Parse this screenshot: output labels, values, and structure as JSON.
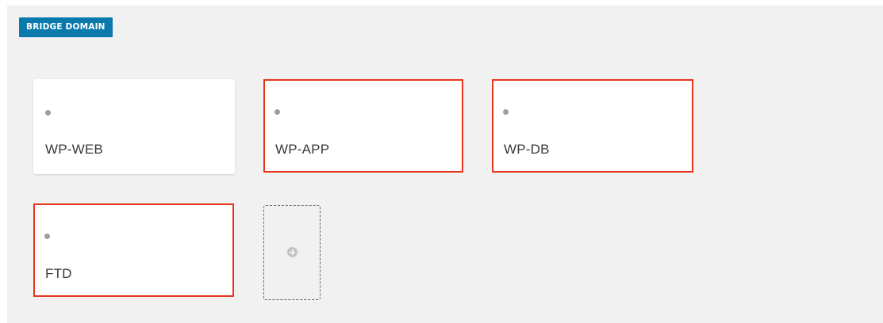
{
  "section": {
    "badge_label": "BRIDGE DOMAIN",
    "badge_color": "#0a7aad"
  },
  "cards": [
    {
      "label": "WP-WEB",
      "highlighted": false
    },
    {
      "label": "WP-APP",
      "highlighted": true
    },
    {
      "label": "WP-DB",
      "highlighted": true
    },
    {
      "label": "FTD",
      "highlighted": true
    }
  ],
  "add_tile": {
    "icon": "plus-circle-icon"
  },
  "colors": {
    "highlight_border": "#e8351c",
    "panel_background": "#f1f1f1",
    "status_dot": "#9e9e9e"
  }
}
